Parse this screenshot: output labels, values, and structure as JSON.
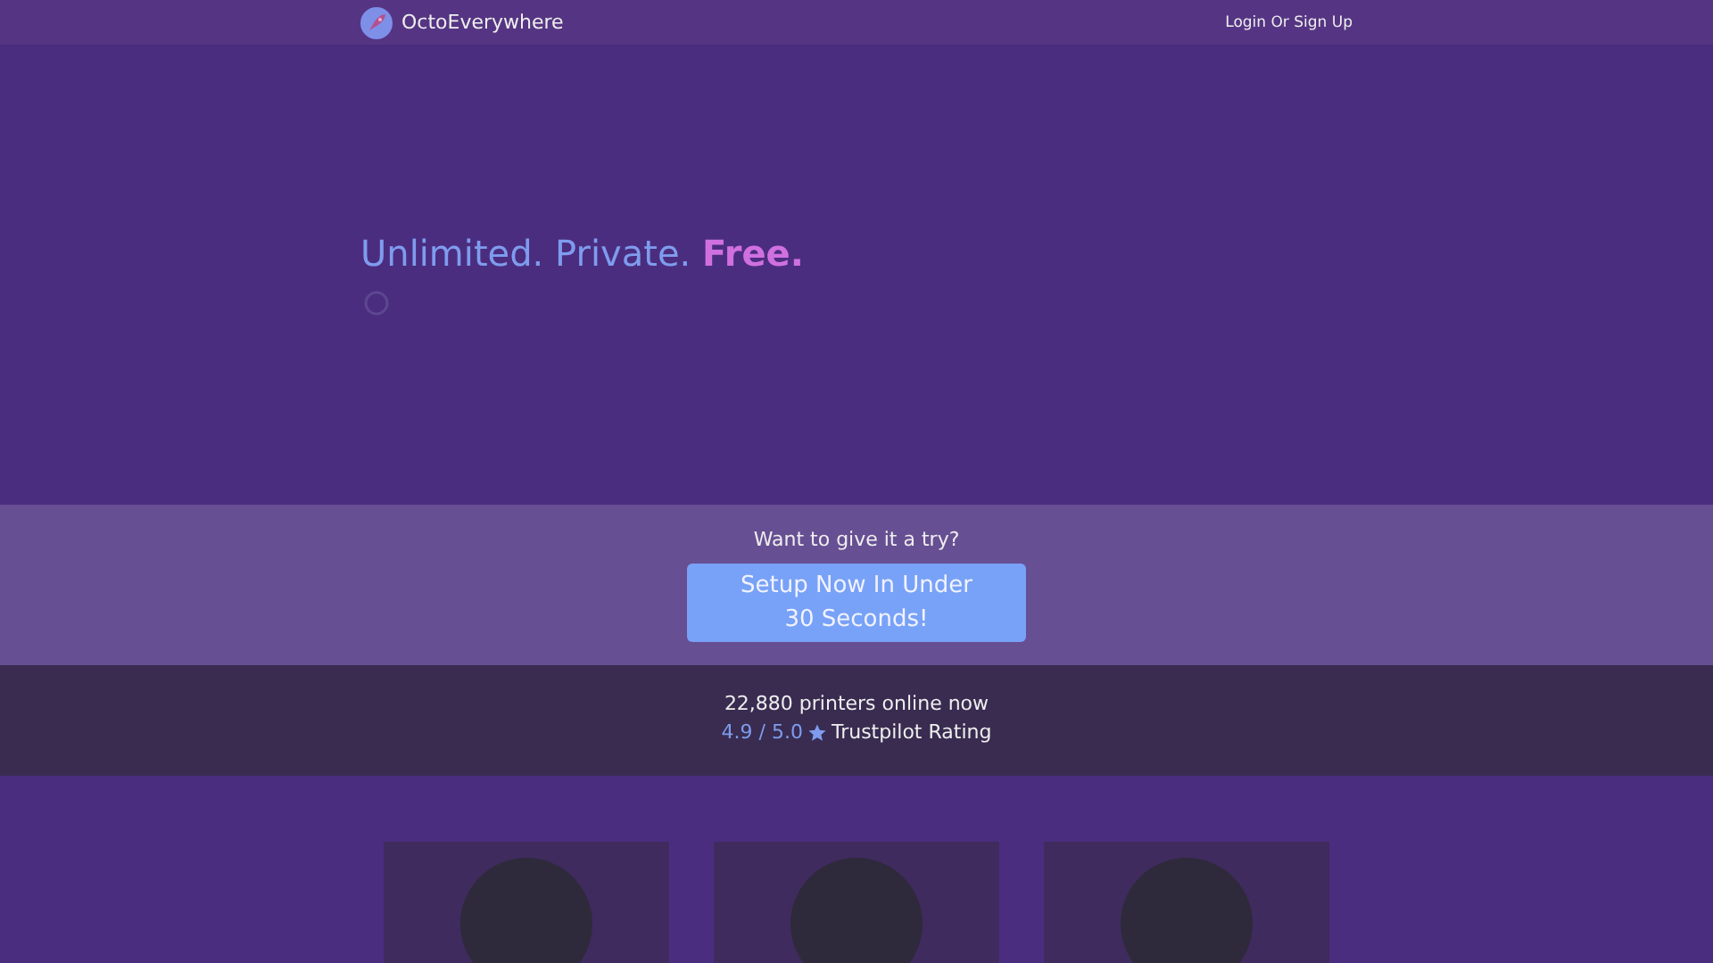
{
  "nav": {
    "brand": "OctoEverywhere",
    "link": "Login Or Sign Up"
  },
  "hero": {
    "headline": "Unlimited. Private. **Free.**",
    "loading": true
  },
  "cta": {
    "prompt": "Want to give it a try?",
    "button": "Setup Now In Under 30 Seconds!"
  },
  "stats": {
    "printers": "22,880 printers online now",
    "rating": "4.9 / 5.0",
    "rating_label": "Trustpilot Rating"
  },
  "cards": [
    {
      "kind": "placeholder"
    },
    {
      "kind": "placeholder"
    },
    {
      "kind": "placeholder"
    }
  ]
}
